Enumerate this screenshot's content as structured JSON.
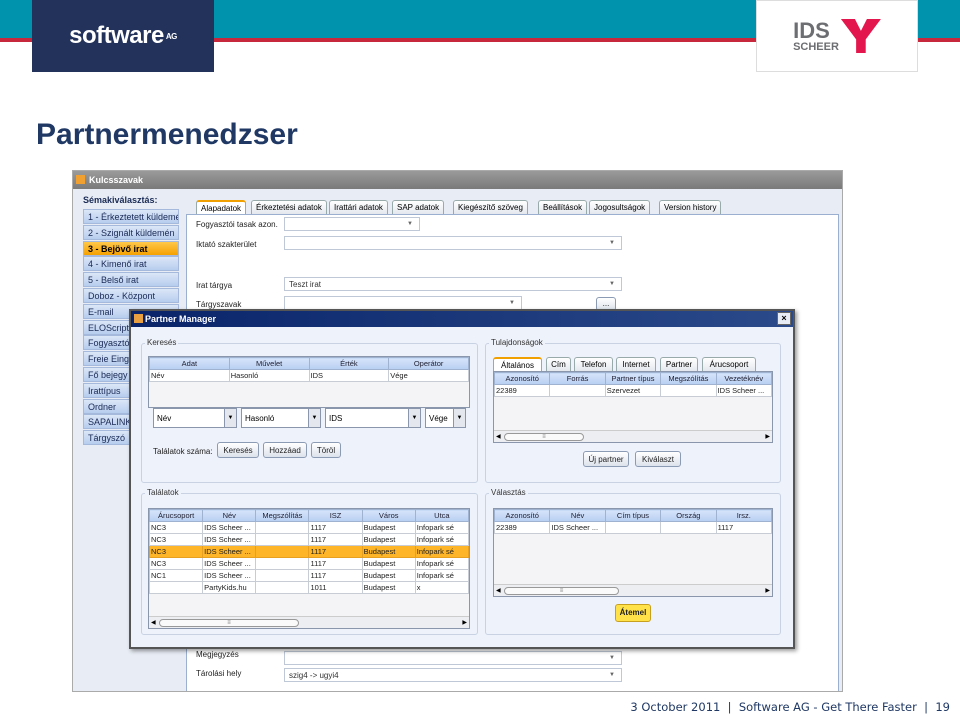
{
  "slide": {
    "title": "Partnermenedzser",
    "footer": "3 October 2011  |  Software AG - Get There Faster  |  19",
    "logo_left": "software",
    "logo_left_sup": "AG",
    "logo_right_1": "IDS",
    "logo_right_2": "SCHEER",
    "colors": {
      "band": "#0093ad",
      "red": "#c8283c",
      "navy": "#22325a",
      "title": "#1f3864"
    }
  },
  "window": {
    "title": "Kulcsszavak",
    "sidebar_heading": "Sémakiválasztás:",
    "sidebar": [
      "1 - Érkeztetett küldemé",
      "2 - Szignált küldemén",
      "3 - Bejövő irat",
      "4 - Kimenő irat",
      "5 - Belső irat",
      "Doboz - Központ",
      "E-mail",
      "ELOScript",
      "Fogyasztó",
      "Freie Eing",
      "Fő bejegy",
      "Irattípus",
      "Ordner",
      "SAPALINK",
      "Tárgyszó"
    ],
    "sidebar_selected": 2,
    "tabs": [
      "Alapadatok",
      "Érkeztetési adatok",
      "Irattári adatok",
      "SAP adatok",
      "Kiegészítő szöveg",
      "Beállítások",
      "Jogosultságok",
      "Version history"
    ],
    "fields": {
      "fogyasztoi_label": "Fogyasztói tasak azon.",
      "iktato_label": "Iktató szakterület",
      "irat_targya_label": "Irat tárgya",
      "irat_targya_value": "Teszt irat",
      "targyszavak_label": "Tárgyszavak",
      "megjegyzes_label": "Megjegyzés",
      "tarolasi_label": "Tárolási hely",
      "tarolasi_value": "szig4 -> ugyi4",
      "more_button": "..."
    }
  },
  "dialog": {
    "title": "Partner Manager",
    "close": "×",
    "kereses": {
      "legend": "Keresés",
      "columns": [
        "Adat",
        "Művelet",
        "Érték",
        "Operátor"
      ],
      "rows": [
        [
          "Név",
          "Hasonló",
          "IDS",
          "Vége"
        ]
      ],
      "combos": [
        "Név",
        "Hasonló",
        "IDS",
        "Vége"
      ],
      "count_label": "Találatok száma:",
      "buttons": [
        "Keresés",
        "Hozzáad",
        "Töröl"
      ]
    },
    "tulajdonsagok": {
      "legend": "Tulajdonságok",
      "tabs": [
        "Általános",
        "Cím",
        "Telefon",
        "Internet",
        "Partner",
        "Árucsoport"
      ],
      "columns": [
        "Azonosító",
        "Forrás",
        "Partner típus",
        "Megszólítás",
        "Vezetéknév"
      ],
      "rows": [
        [
          "22389",
          "",
          "Szervezet",
          "",
          "IDS Scheer ..."
        ]
      ],
      "buttons": [
        "Új partner",
        "Kiválaszt"
      ]
    },
    "talalatok": {
      "legend": "Találatok",
      "columns": [
        "Árucsoport",
        "Név",
        "Megszólítás",
        "ISZ",
        "Város",
        "Utca"
      ],
      "rows": [
        [
          "NC3",
          "IDS Scheer ...",
          "",
          "1117",
          "Budapest",
          "Infopark sé"
        ],
        [
          "NC3",
          "IDS Scheer ...",
          "",
          "1117",
          "Budapest",
          "Infopark sé"
        ],
        [
          "NC3",
          "IDS Scheer ...",
          "",
          "1117",
          "Budapest",
          "Infopark sé"
        ],
        [
          "NC3",
          "IDS Scheer ...",
          "",
          "1117",
          "Budapest",
          "Infopark sé"
        ],
        [
          "NC1",
          "IDS Scheer ...",
          "",
          "1117",
          "Budapest",
          "Infopark sé"
        ],
        [
          "",
          "PartyKids.hu",
          "",
          "1011",
          "Budapest",
          "x"
        ]
      ],
      "selected_row": 2
    },
    "valasztas": {
      "legend": "Választás",
      "columns": [
        "Azonosító",
        "Név",
        "Cím típus",
        "Ország",
        "Irsz."
      ],
      "rows": [
        [
          "22389",
          "IDS Scheer ...",
          "",
          "",
          "1117"
        ]
      ],
      "button": "Átemel",
      "button_color": "#ffe24a"
    }
  }
}
